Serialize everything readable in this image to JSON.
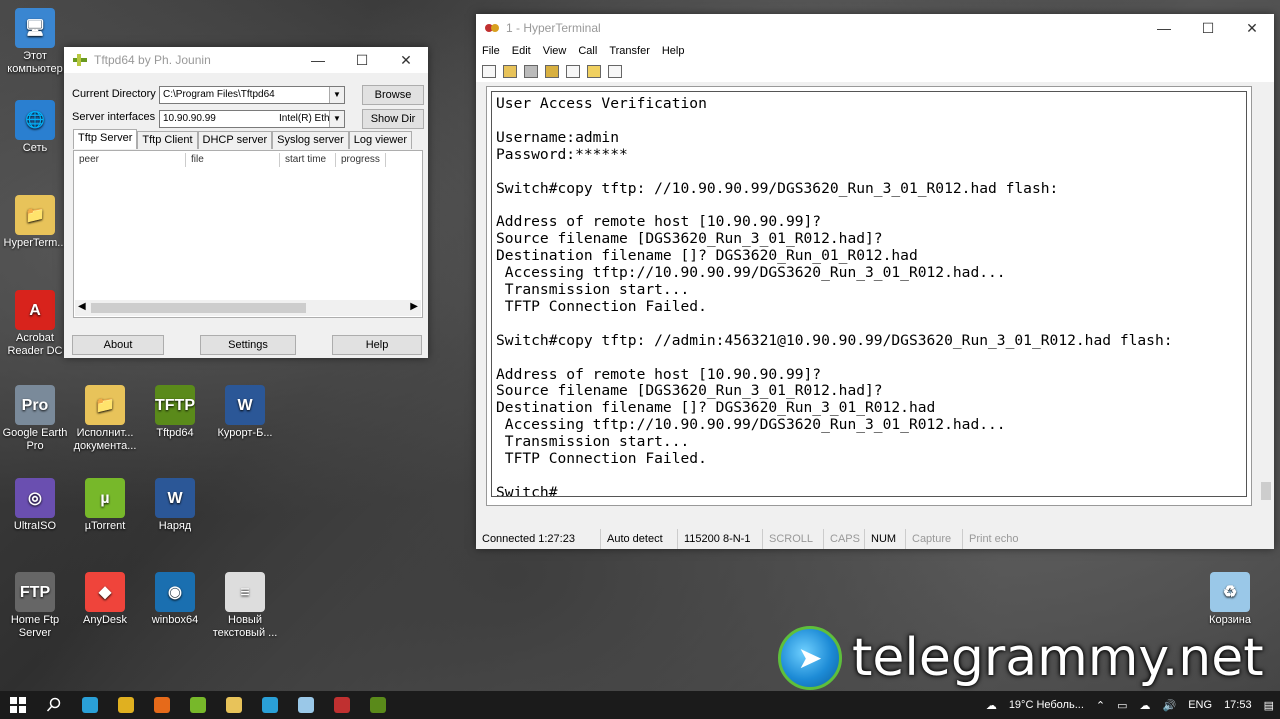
{
  "desktop": {
    "icons": [
      {
        "label": "Этот компьютер",
        "color": "#3a86d1",
        "glyph": "🖥"
      },
      {
        "label": "Сеть",
        "color": "#2a7fd0",
        "glyph": "🌐"
      },
      {
        "label": "HyperTerm...",
        "color": "#e8c35a",
        "glyph": "📁"
      },
      {
        "label": "Acrobat Reader DC",
        "color": "#d8231c",
        "glyph": "A"
      },
      {
        "label": "Google Earth Pro",
        "color": "#7a8a9a",
        "glyph": "Pro"
      },
      {
        "label": "UltraISO",
        "color": "#6a4fb0",
        "glyph": "◎"
      },
      {
        "label": "Home Ftp Server",
        "color": "#666666",
        "glyph": "FTP"
      },
      {
        "label": "Исполнит... документа...",
        "color": "#e8c35a",
        "glyph": "📁"
      },
      {
        "label": "Tftpd64",
        "color": "#5a8a1a",
        "glyph": "TFTP"
      },
      {
        "label": "Курорт-Б...",
        "color": "#2b5797",
        "glyph": "W"
      },
      {
        "label": "µTorrent",
        "color": "#77b82a",
        "glyph": "µ"
      },
      {
        "label": "Наряд",
        "color": "#2b5797",
        "glyph": "W"
      },
      {
        "label": "AnyDesk",
        "color": "#ef443b",
        "glyph": "◆"
      },
      {
        "label": "winbox64",
        "color": "#1a6fb0",
        "glyph": "◉"
      },
      {
        "label": "Новый текстовый ...",
        "color": "#dddddd",
        "glyph": "≡"
      },
      {
        "label": "Корзина",
        "color": "#9ac8e8",
        "glyph": "♻"
      }
    ]
  },
  "tftpd": {
    "title": "Tftpd64 by Ph. Jounin",
    "current_dir_label": "Current Directory",
    "current_dir_value": "C:\\Program Files\\Tftpd64",
    "server_if_label": "Server interfaces",
    "server_if_ip": "10.90.90.99",
    "server_if_adapter": "Intel(R) Eth",
    "browse": "Browse",
    "show_dir": "Show Dir",
    "tabs": [
      "Tftp Server",
      "Tftp Client",
      "DHCP server",
      "Syslog server",
      "Log viewer"
    ],
    "columns": [
      "peer",
      "file",
      "start time",
      "progress"
    ],
    "about": "About",
    "settings": "Settings",
    "help": "Help"
  },
  "hyperterminal": {
    "title": "1 - HyperTerminal",
    "menu": [
      "File",
      "Edit",
      "View",
      "Call",
      "Transfer",
      "Help"
    ],
    "terminal_text": "User Access Verification\n\nUsername:admin\nPassword:******\n\nSwitch#copy tftp: //10.90.90.99/DGS3620_Run_3_01_R012.had flash:\n\nAddress of remote host [10.90.90.99]?\nSource filename [DGS3620_Run_3_01_R012.had]?\nDestination filename []? DGS3620_Run_01_R012.had\n Accessing tftp://10.90.90.99/DGS3620_Run_3_01_R012.had...\n Transmission start...\n TFTP Connection Failed.\n\nSwitch#copy tftp: //admin:456321@10.90.90.99/DGS3620_Run_3_01_R012.had flash:\n\nAddress of remote host [10.90.90.99]?\nSource filename [DGS3620_Run_3_01_R012.had]?\nDestination filename []? DGS3620_Run_3_01_R012.had\n Accessing tftp://10.90.90.99/DGS3620_Run_3_01_R012.had...\n Transmission start...\n TFTP Connection Failed.\n\nSwitch#_",
    "status": {
      "connected": "Connected 1:27:23",
      "detect": "Auto detect",
      "baud": "115200 8-N-1",
      "scroll": "SCROLL",
      "caps": "CAPS",
      "num": "NUM",
      "capture": "Capture",
      "print_echo": "Print echo"
    }
  },
  "watermark": "telegrammy.net",
  "taskbar": {
    "weather": "19°C Неболь...",
    "lang": "ENG",
    "time": "17:53",
    "apps": [
      {
        "name": "edge",
        "color": "#2aa0d8"
      },
      {
        "name": "chrome",
        "color": "#e0b020"
      },
      {
        "name": "firefox",
        "color": "#e66a1a"
      },
      {
        "name": "utorrent",
        "color": "#77b82a"
      },
      {
        "name": "explorer",
        "color": "#e8c35a"
      },
      {
        "name": "telegram",
        "color": "#2aa0d8"
      },
      {
        "name": "notepad",
        "color": "#9ac8e8"
      },
      {
        "name": "hyperterminal",
        "color": "#c03030"
      },
      {
        "name": "tftpd",
        "color": "#5a8a1a"
      }
    ]
  }
}
